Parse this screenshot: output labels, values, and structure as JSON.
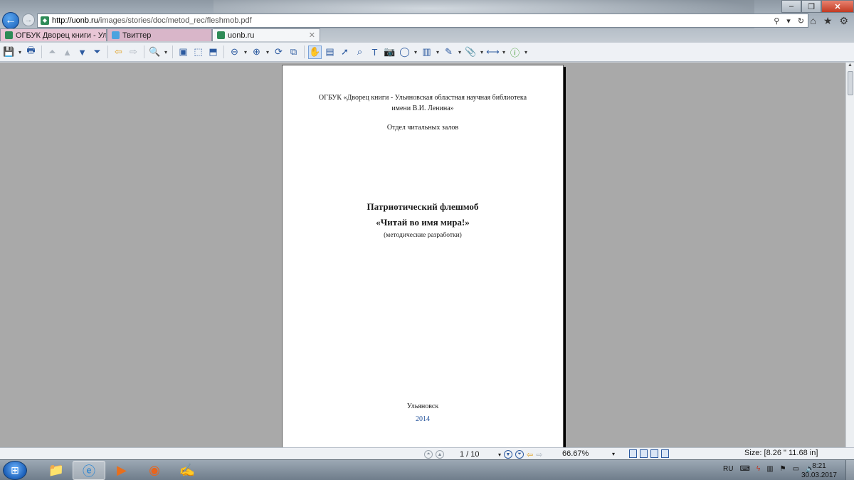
{
  "browser": {
    "address": {
      "domain": "http://uonb.ru",
      "path": "/images/stories/doc/metod_rec/fleshmob.pdf"
    },
    "tabs": [
      {
        "label": "ОГБУК Дворец книги - Ульян..."
      },
      {
        "label": "Твиттер"
      },
      {
        "label": "uonb.ru"
      }
    ]
  },
  "document": {
    "org_line1": "ОГБУК «Дворец книги - Ульяновская областная научная библиотека",
    "org_line2": "имени В.И. Ленина»",
    "department": "Отдел читальных залов",
    "title_line1": "Патриотический флешмоб",
    "title_line2": "«Читай во имя мира!»",
    "subtitle": "(методические разработки)",
    "city": "Ульяновск",
    "year": "2014"
  },
  "statusbar": {
    "page": "1 / 10",
    "zoom": "66.67%",
    "size": "Size: [8.26 \" 11.68 in]"
  },
  "taskbar": {
    "language": "RU",
    "time": "8:21",
    "date": "30.03.2017"
  },
  "colors": {
    "accent": "#2c5aa0",
    "year_text": "#1f4f99",
    "viewer_bg": "#a9a9a9"
  },
  "icons": {
    "back": "arrow-left-icon",
    "forward": "arrow-right-icon",
    "home": "home-icon",
    "favorites": "star-icon",
    "tools": "gear-icon"
  }
}
